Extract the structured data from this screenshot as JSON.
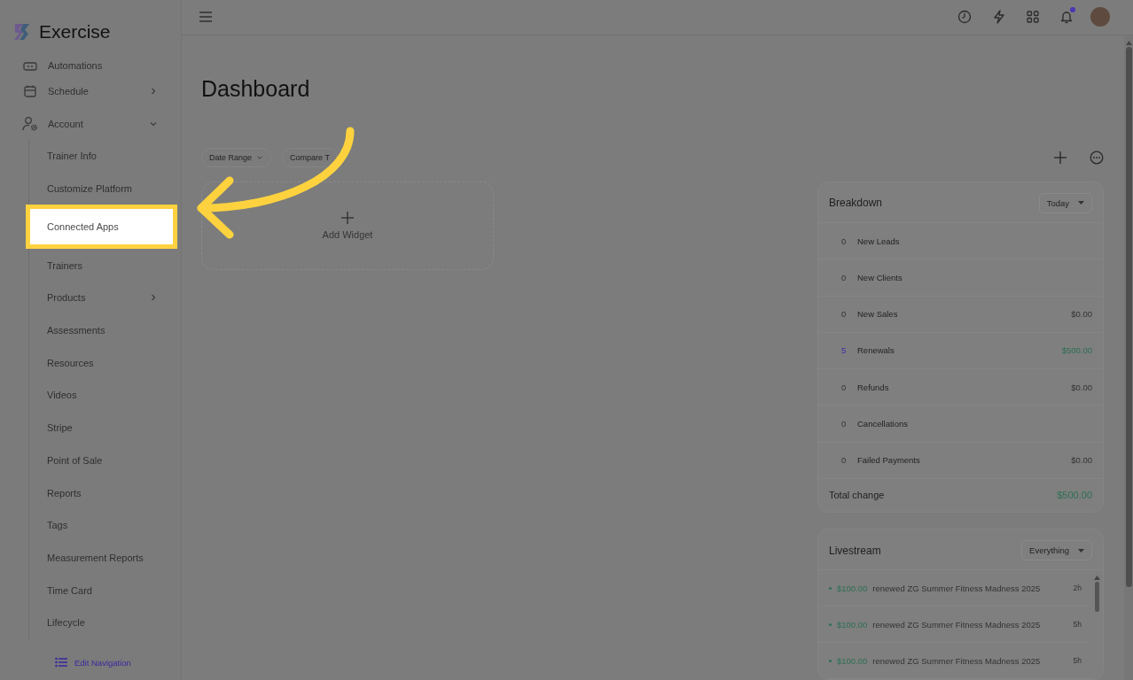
{
  "brand": {
    "name": "Exercise"
  },
  "sidebar": {
    "items": [
      {
        "label": "Automations"
      },
      {
        "label": "Schedule",
        "expanded": false
      },
      {
        "label": "Account",
        "expanded": true,
        "children": [
          {
            "label": "Trainer Info",
            "selected": false
          },
          {
            "label": "Customize Platform",
            "selected": false
          },
          {
            "label": "Connected Apps",
            "selected": true
          },
          {
            "label": "Trainers",
            "selected": false
          },
          {
            "label": "Products",
            "selected": false,
            "expanded": false
          },
          {
            "label": "Assessments",
            "selected": false
          },
          {
            "label": "Resources",
            "selected": false
          },
          {
            "label": "Videos",
            "selected": false
          },
          {
            "label": "Stripe",
            "selected": false
          },
          {
            "label": "Point of Sale",
            "selected": false
          },
          {
            "label": "Reports",
            "selected": false
          },
          {
            "label": "Tags",
            "selected": false
          },
          {
            "label": "Measurement Reports",
            "selected": false
          },
          {
            "label": "Time Card",
            "selected": false
          },
          {
            "label": "Lifecycle",
            "selected": false
          }
        ]
      }
    ],
    "edit_link": "Edit Navigation"
  },
  "header": {
    "notification_unread": true
  },
  "page": {
    "title": "Dashboard",
    "filters": [
      "Date Range",
      "Compare T"
    ],
    "add_widget": "Add Widget"
  },
  "breakdown": {
    "title": "Breakdown",
    "period": "Today",
    "rows": [
      {
        "count": "0",
        "label": "New Leads",
        "highlighted": false
      },
      {
        "count": "0",
        "label": "New Clients",
        "highlighted": false
      },
      {
        "count": "0",
        "label": "New Sales",
        "amount": "$0.00",
        "highlighted": false
      },
      {
        "count": "5",
        "label": "Renewals",
        "amount": "$500.00",
        "highlighted": true
      },
      {
        "count": "0",
        "label": "Refunds",
        "amount": "$0.00",
        "highlighted": false
      },
      {
        "count": "0",
        "label": "Cancellations",
        "highlighted": false
      },
      {
        "count": "0",
        "label": "Failed Payments",
        "amount": "$0.00",
        "highlighted": false
      }
    ],
    "total_label": "Total change",
    "total_amount": "$500.00"
  },
  "livestream": {
    "title": "Livestream",
    "filter": "Everything",
    "items": [
      {
        "amount": "$100.00",
        "text": "renewed ZG Summer Fitness Madness 2025",
        "time": "2h"
      },
      {
        "amount": "$100.00",
        "text": "renewed ZG Summer Fitness Madness 2025",
        "time": "5h"
      },
      {
        "amount": "$100.00",
        "text": "renewed ZG Summer Fitness Madness 2025",
        "time": "5h"
      }
    ]
  }
}
